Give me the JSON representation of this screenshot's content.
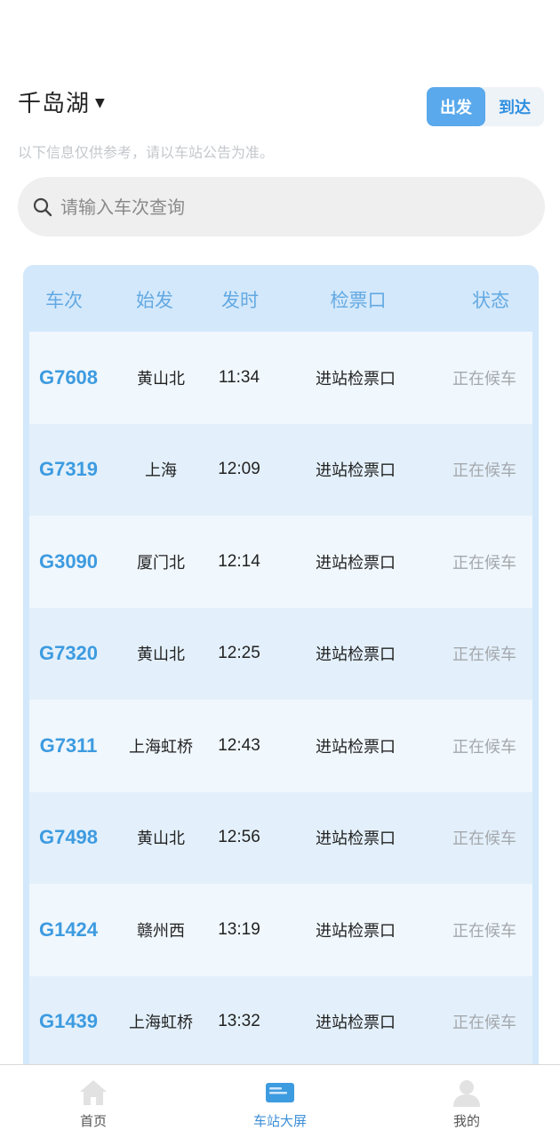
{
  "header": {
    "station": "千岛湖",
    "toggle": {
      "depart": "出发",
      "arrive": "到达"
    }
  },
  "notice": "以下信息仅供参考，请以车站公告为准。",
  "search": {
    "placeholder": "请输入车次查询",
    "value": ""
  },
  "board": {
    "columns": [
      "车次",
      "始发",
      "发时",
      "检票口",
      "状态"
    ],
    "rows": [
      {
        "train": "G7608",
        "origin": "黄山北",
        "time": "11:34",
        "gate": "进站检票口",
        "status": "正在候车"
      },
      {
        "train": "G7319",
        "origin": "上海",
        "time": "12:09",
        "gate": "进站检票口",
        "status": "正在候车"
      },
      {
        "train": "G3090",
        "origin": "厦门北",
        "time": "12:14",
        "gate": "进站检票口",
        "status": "正在候车"
      },
      {
        "train": "G7320",
        "origin": "黄山北",
        "time": "12:25",
        "gate": "进站检票口",
        "status": "正在候车"
      },
      {
        "train": "G7311",
        "origin": "上海虹桥",
        "time": "12:43",
        "gate": "进站检票口",
        "status": "正在候车"
      },
      {
        "train": "G7498",
        "origin": "黄山北",
        "time": "12:56",
        "gate": "进站检票口",
        "status": "正在候车"
      },
      {
        "train": "G1424",
        "origin": "赣州西",
        "time": "13:19",
        "gate": "进站检票口",
        "status": "正在候车"
      },
      {
        "train": "G1439",
        "origin": "上海虹桥",
        "time": "13:32",
        "gate": "进站检票口",
        "status": "正在候车"
      }
    ]
  },
  "tabbar": {
    "items": [
      {
        "label": "首页",
        "icon": "home-icon"
      },
      {
        "label": "车站大屏",
        "icon": "station-screen-icon"
      },
      {
        "label": "我的",
        "icon": "user-icon"
      }
    ]
  },
  "colors": {
    "accent": "#5aa9ec",
    "train_no": "#3d9be0",
    "board_bg": "#d3e8fb"
  }
}
